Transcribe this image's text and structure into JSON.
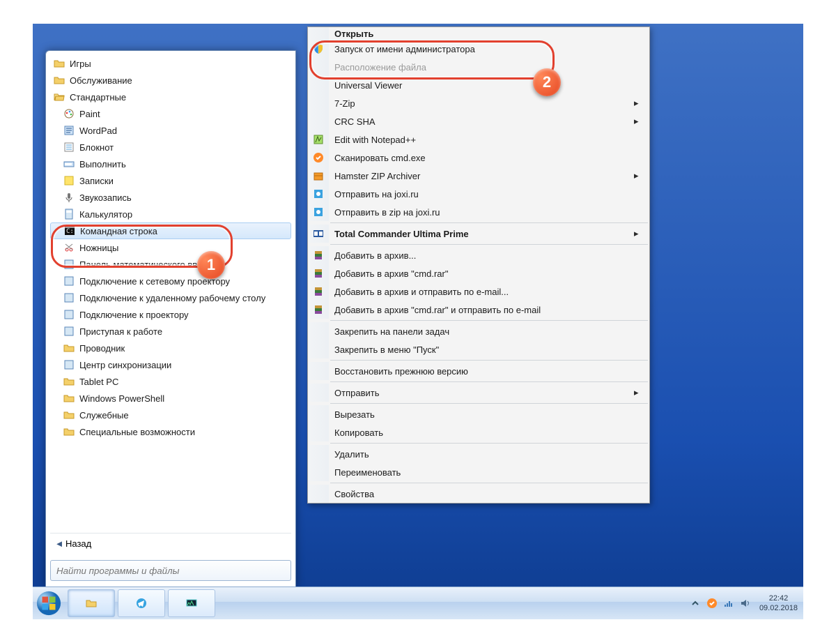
{
  "startmenu": {
    "items": [
      {
        "label": "Игры",
        "type": "folder"
      },
      {
        "label": "Обслуживание",
        "type": "folder"
      },
      {
        "label": "Стандартные",
        "type": "folder-open"
      },
      {
        "label": "Paint",
        "type": "app",
        "icon": "paint"
      },
      {
        "label": "WordPad",
        "type": "app",
        "icon": "wordpad"
      },
      {
        "label": "Блокнот",
        "type": "app",
        "icon": "notepad"
      },
      {
        "label": "Выполнить",
        "type": "app",
        "icon": "run"
      },
      {
        "label": "Записки",
        "type": "app",
        "icon": "notes"
      },
      {
        "label": "Звукозапись",
        "type": "app",
        "icon": "mic"
      },
      {
        "label": "Калькулятор",
        "type": "app",
        "icon": "calc"
      },
      {
        "label": "Командная строка",
        "type": "app",
        "icon": "cmd",
        "selected": true
      },
      {
        "label": "Ножницы",
        "type": "app",
        "icon": "snip"
      },
      {
        "label": "Панель математического ввода",
        "type": "app",
        "icon": "math"
      },
      {
        "label": "Подключение к сетевому проектору",
        "type": "app",
        "icon": "netproj"
      },
      {
        "label": "Подключение к удаленному рабочему столу",
        "type": "app",
        "icon": "rdp"
      },
      {
        "label": "Подключение к проектору",
        "type": "app",
        "icon": "proj"
      },
      {
        "label": "Приступая к работе",
        "type": "app",
        "icon": "welcome"
      },
      {
        "label": "Проводник",
        "type": "app",
        "icon": "explorer"
      },
      {
        "label": "Центр синхронизации",
        "type": "app",
        "icon": "sync"
      },
      {
        "label": "Tablet PC",
        "type": "folder"
      },
      {
        "label": "Windows PowerShell",
        "type": "folder"
      },
      {
        "label": "Служебные",
        "type": "folder"
      },
      {
        "label": "Специальные возможности",
        "type": "folder"
      }
    ],
    "back": "Назад",
    "search_placeholder": "Найти программы и файлы"
  },
  "context": {
    "header": "Открыть",
    "items": [
      {
        "label": "Запуск от имени администратора",
        "icon": "shield",
        "highlight": true
      },
      {
        "label": "Расположение файла",
        "muted": true
      },
      {
        "label": "Universal Viewer"
      },
      {
        "label": "7-Zip",
        "submenu": true
      },
      {
        "label": "CRC SHA",
        "submenu": true
      },
      {
        "label": "Edit with Notepad++",
        "icon": "npp"
      },
      {
        "label": "Сканировать cmd.exe",
        "icon": "avast"
      },
      {
        "label": "Hamster ZIP Archiver",
        "icon": "hamster",
        "submenu": true
      },
      {
        "label": "Отправить на joxi.ru",
        "icon": "joxi"
      },
      {
        "label": "Отправить в zip на joxi.ru",
        "icon": "joxi"
      },
      {
        "sep": true
      },
      {
        "label": "Total Commander Ultima Prime",
        "icon": "tc",
        "submenu": true,
        "bold": true
      },
      {
        "sep": true
      },
      {
        "label": "Добавить в архив...",
        "icon": "rar"
      },
      {
        "label": "Добавить в архив \"cmd.rar\"",
        "icon": "rar"
      },
      {
        "label": "Добавить в архив и отправить по e-mail...",
        "icon": "rar"
      },
      {
        "label": "Добавить в архив \"cmd.rar\" и отправить по e-mail",
        "icon": "rar"
      },
      {
        "sep": true
      },
      {
        "label": "Закрепить на панели задач"
      },
      {
        "label": "Закрепить в меню \"Пуск\""
      },
      {
        "sep": true
      },
      {
        "label": "Восстановить прежнюю версию"
      },
      {
        "sep": true
      },
      {
        "label": "Отправить",
        "submenu": true
      },
      {
        "sep": true
      },
      {
        "label": "Вырезать"
      },
      {
        "label": "Копировать"
      },
      {
        "sep": true
      },
      {
        "label": "Удалить"
      },
      {
        "label": "Переименовать"
      },
      {
        "sep": true
      },
      {
        "label": "Свойства"
      }
    ]
  },
  "taskbar": {
    "pinned": [
      "explorer",
      "telegram",
      "monitor"
    ],
    "tray_icons": [
      "chevron",
      "avast",
      "net",
      "vol"
    ],
    "clock_time": "22:42",
    "clock_date": "09.02.2018"
  },
  "annotations": {
    "bubble1": "1",
    "bubble2": "2"
  }
}
